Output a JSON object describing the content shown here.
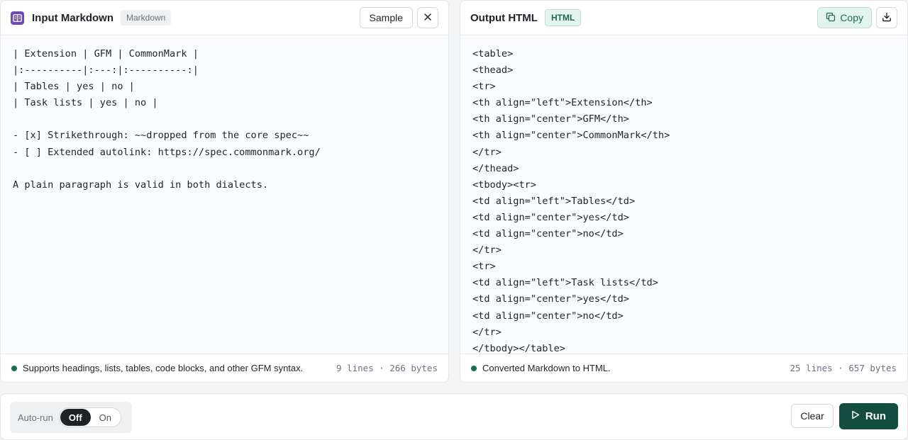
{
  "input_panel": {
    "title": "Input Markdown",
    "badge": "Markdown",
    "sample_label": "Sample",
    "clear_icon": "close-icon",
    "code": "| Extension | GFM | CommonMark |\n|:----------|:---:|:----------:|\n| Tables | yes | no |\n| Task lists | yes | no |\n\n- [x] Strikethrough: ~~dropped from the core spec~~\n- [ ] Extended autolink: https://spec.commonmark.org/\n\nA plain paragraph is valid in both dialects.",
    "status": "Supports headings, lists, tables, code blocks, and other GFM syntax.",
    "stats": "9 lines · 266 bytes"
  },
  "output_panel": {
    "title": "Output HTML",
    "badge": "HTML",
    "copy_label": "Copy",
    "download_icon": "download-icon",
    "code": "<table>\n<thead>\n<tr>\n<th align=\"left\">Extension</th>\n<th align=\"center\">GFM</th>\n<th align=\"center\">CommonMark</th>\n</tr>\n</thead>\n<tbody><tr>\n<td align=\"left\">Tables</td>\n<td align=\"center\">yes</td>\n<td align=\"center\">no</td>\n</tr>\n<tr>\n<td align=\"left\">Task lists</td>\n<td align=\"center\">yes</td>\n<td align=\"center\">no</td>\n</tr>\n</tbody></table>",
    "status": "Converted Markdown to HTML.",
    "stats": "25 lines · 657 bytes"
  },
  "bottom_bar": {
    "autorun_label": "Auto-run",
    "toggle_off": "Off",
    "toggle_on": "On",
    "toggle_selected": "Off",
    "clear_label": "Clear",
    "run_label": "Run"
  },
  "colors": {
    "accent": "#134d3f",
    "status_dot": "#1d6b52",
    "app_icon": "#6b4bb5"
  }
}
